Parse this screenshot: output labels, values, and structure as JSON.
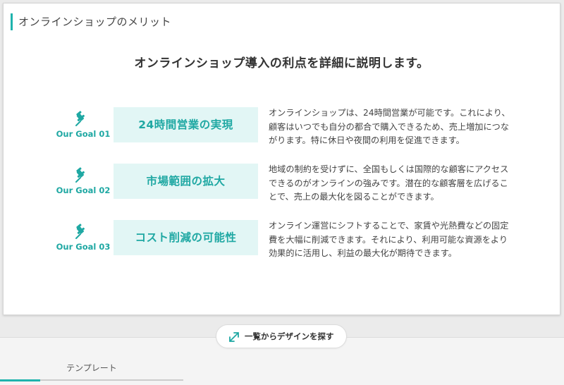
{
  "section_title": "オンラインショップのメリット",
  "headline": "オンラインショップ導入の利点を詳細に説明します。",
  "goals": [
    {
      "label": "Our Goal 01",
      "title": "24時間営業の実現",
      "description": "オンラインショップは、24時間営業が可能です。これにより、顧客はいつでも自分の都合で購入できるため、売上増加につながります。特に休日や夜間の利用を促進できます。",
      "icon": "pushpin-icon"
    },
    {
      "label": "Our Goal 02",
      "title": "市場範囲の拡大",
      "description": "地域の制約を受けずに、全国もしくは国際的な顧客にアクセスできるのがオンラインの強みです。潜在的な顧客層を広げることで、売上の最大化を図ることができます。",
      "icon": "pushpin-icon"
    },
    {
      "label": "Our Goal 03",
      "title": "コスト削減の可能性",
      "description": "オンライン運営にシフトすることで、家賃や光熱費などの固定費を大幅に削減できます。それにより、利用可能な資源をより効果的に活用し、利益の最大化が期待できます。",
      "icon": "pushpin-icon"
    }
  ],
  "browse_button": {
    "label": "一覧からデザインを探す",
    "icon": "expand-arrows-icon"
  },
  "tabs": [
    {
      "label": "テンプレート",
      "active": true
    }
  ],
  "colors": {
    "accent": "#1fb3ad",
    "accent_text": "#1fa8a3",
    "goal_box_bg": "#e2f6f5"
  }
}
